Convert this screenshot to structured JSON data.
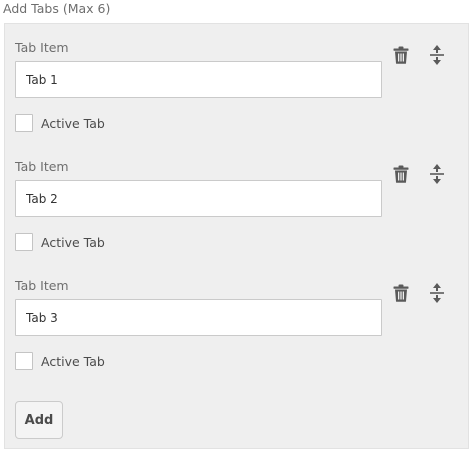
{
  "section": {
    "title": "Add Tabs (Max 6)"
  },
  "icons": {
    "delete": "trash-icon",
    "reorder": "reorder-icon"
  },
  "colors": {
    "panel_bg": "#efefef",
    "icon": "#5a5a5a"
  },
  "tabs": [
    {
      "field_label": "Tab Item",
      "value": "Tab 1",
      "active_label": "Active Tab",
      "active": false
    },
    {
      "field_label": "Tab Item",
      "value": "Tab 2",
      "active_label": "Active Tab",
      "active": false
    },
    {
      "field_label": "Tab Item",
      "value": "Tab 3",
      "active_label": "Active Tab",
      "active": false
    }
  ],
  "add_button": {
    "label": "Add"
  }
}
